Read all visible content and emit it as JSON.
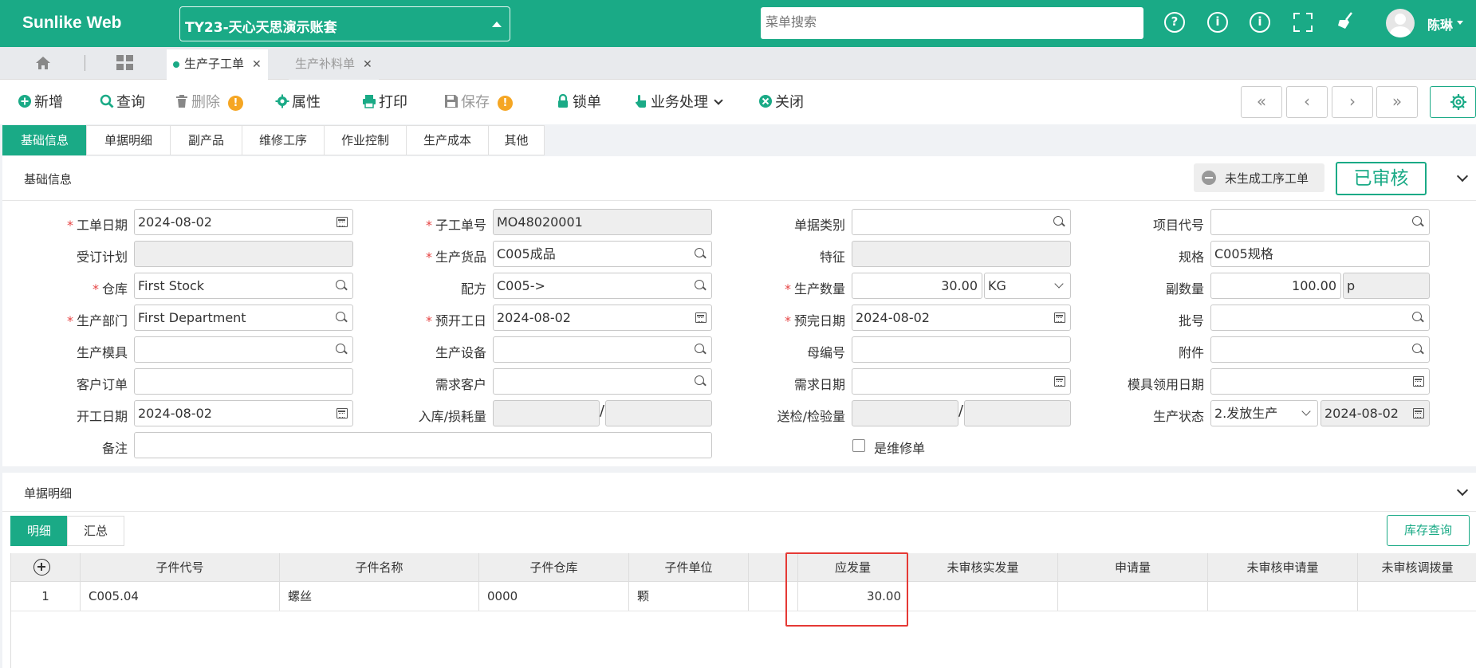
{
  "header": {
    "brand": "Sunlike Web",
    "account": "TY23-天心天思演示账套",
    "menu_search_placeholder": "菜单搜索",
    "user_name": "陈琳",
    "icons": [
      "help-circle-icon",
      "info-icon",
      "info-icon",
      "fullscreen-icon",
      "broom-icon",
      "user-avatar"
    ]
  },
  "window_tabs": [
    {
      "label": "生产子工单",
      "active": true
    },
    {
      "label": "生产补料单",
      "active": false
    }
  ],
  "toolbar": {
    "new": "新增",
    "query": "查询",
    "delete": "删除",
    "properties": "属性",
    "print": "打印",
    "save": "保存",
    "lock": "锁单",
    "business": "业务处理",
    "close": "关闭",
    "nav": [
      "«",
      "‹",
      "›",
      "»"
    ]
  },
  "section_tabs": [
    "基础信息",
    "单据明细",
    "副产品",
    "维修工序",
    "作业控制",
    "生产成本",
    "其他"
  ],
  "basic": {
    "title": "基础信息",
    "status_chip": "未生成工序工单",
    "approved": "已审核"
  },
  "form": {
    "work_date": {
      "label": "工单日期",
      "value": "2024-08-02"
    },
    "sub_order_no": {
      "label": "子工单号",
      "value": "MO48020001"
    },
    "doc_type": {
      "label": "单据类别",
      "value": ""
    },
    "project_code": {
      "label": "项目代号",
      "value": ""
    },
    "order_plan": {
      "label": "受订计划",
      "value": ""
    },
    "product": {
      "label": "生产货品",
      "value": "C005成品"
    },
    "feature": {
      "label": "特征",
      "value": ""
    },
    "spec": {
      "label": "规格",
      "value": "C005规格"
    },
    "warehouse": {
      "label": "仓库",
      "value": "First Stock"
    },
    "formula": {
      "label": "配方",
      "value": "C005->"
    },
    "prod_qty": {
      "label": "生产数量",
      "value": "30.00",
      "unit": "KG"
    },
    "sub_qty": {
      "label": "副数量",
      "value": "100.00",
      "unit": "p"
    },
    "dept": {
      "label": "生产部门",
      "value": "First Department"
    },
    "plan_start": {
      "label": "预开工日",
      "value": "2024-08-02"
    },
    "plan_finish": {
      "label": "预完日期",
      "value": "2024-08-02"
    },
    "batch": {
      "label": "批号",
      "value": ""
    },
    "mold": {
      "label": "生产模具",
      "value": ""
    },
    "equipment": {
      "label": "生产设备",
      "value": ""
    },
    "parent_no": {
      "label": "母编号",
      "value": ""
    },
    "attachment": {
      "label": "附件",
      "value": ""
    },
    "cust_order": {
      "label": "客户订单",
      "value": ""
    },
    "demand_cust": {
      "label": "需求客户",
      "value": ""
    },
    "demand_date": {
      "label": "需求日期",
      "value": ""
    },
    "mold_date": {
      "label": "模具领用日期",
      "value": ""
    },
    "start_date": {
      "label": "开工日期",
      "value": "2024-08-02"
    },
    "in_loss": {
      "label": "入库/损耗量",
      "sep": "/"
    },
    "inspect": {
      "label": "送检/检验量",
      "sep": "/"
    },
    "prod_status": {
      "label": "生产状态",
      "value": "2.发放生产",
      "date": "2024-08-02"
    },
    "remark": {
      "label": "备注",
      "value": ""
    },
    "repair": {
      "label": "是维修单",
      "checked": false
    }
  },
  "detail": {
    "title": "单据明细",
    "tabs": [
      "明细",
      "汇总"
    ],
    "stock_query": "库存查询",
    "columns": [
      "",
      "子件代号",
      "子件名称",
      "子件仓库",
      "子件单位",
      "",
      "应发量",
      "未审核实发量",
      "申请量",
      "未审核申请量",
      "未审核调拨量"
    ],
    "rows": [
      [
        "1",
        "C005.04",
        "螺丝",
        "0000",
        "颗",
        "",
        "30.00",
        "",
        "",
        "",
        ""
      ]
    ]
  },
  "colors": {
    "accent": "#1aaa86",
    "highlight": "#e53935",
    "required": "#e64545"
  }
}
